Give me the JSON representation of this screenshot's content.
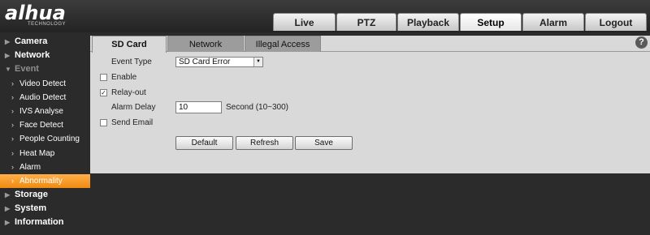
{
  "brand": {
    "logo_text": "alhua",
    "logo_sub": "TECHNOLOGY"
  },
  "topnav": {
    "tabs": [
      {
        "label": "Live",
        "active": false
      },
      {
        "label": "PTZ",
        "active": false
      },
      {
        "label": "Playback",
        "active": false
      },
      {
        "label": "Setup",
        "active": true
      },
      {
        "label": "Alarm",
        "active": false
      },
      {
        "label": "Logout",
        "active": false
      }
    ]
  },
  "sidebar": {
    "items": [
      {
        "label": "Camera",
        "level": "top",
        "expanded": false
      },
      {
        "label": "Network",
        "level": "top",
        "expanded": false
      },
      {
        "label": "Event",
        "level": "top",
        "expanded": true
      },
      {
        "label": "Video Detect",
        "level": "sub"
      },
      {
        "label": "Audio Detect",
        "level": "sub"
      },
      {
        "label": "IVS Analyse",
        "level": "sub"
      },
      {
        "label": "Face Detect",
        "level": "sub"
      },
      {
        "label": "People Counting",
        "level": "sub"
      },
      {
        "label": "Heat Map",
        "level": "sub"
      },
      {
        "label": "Alarm",
        "level": "sub"
      },
      {
        "label": "Abnormality",
        "level": "sub",
        "active": true
      },
      {
        "label": "Storage",
        "level": "top",
        "expanded": false
      },
      {
        "label": "System",
        "level": "top",
        "expanded": false
      },
      {
        "label": "Information",
        "level": "top",
        "expanded": false
      }
    ]
  },
  "subtabs": [
    {
      "label": "SD Card",
      "active": true
    },
    {
      "label": "Network",
      "active": false
    },
    {
      "label": "Illegal Access",
      "active": false
    }
  ],
  "form": {
    "event_type_label": "Event Type",
    "event_type_value": "SD Card Error",
    "enable_label": "Enable",
    "enable_checked": false,
    "relay_out_label": "Relay-out",
    "relay_out_checked": true,
    "alarm_delay_label": "Alarm Delay",
    "alarm_delay_value": "10",
    "alarm_delay_unit": "Second (10~300)",
    "send_email_label": "Send Email",
    "send_email_checked": false
  },
  "buttons": {
    "default": "Default",
    "refresh": "Refresh",
    "save": "Save"
  },
  "icons": {
    "help": "?",
    "dropdown": "▼",
    "collapsed": "▶",
    "expanded": "▼",
    "sub_arrow": "›",
    "check": "✓"
  },
  "colors": {
    "accent_orange": "#f08a10",
    "panel_bg": "#d9d9d9",
    "page_bg": "#2b2b2b"
  }
}
